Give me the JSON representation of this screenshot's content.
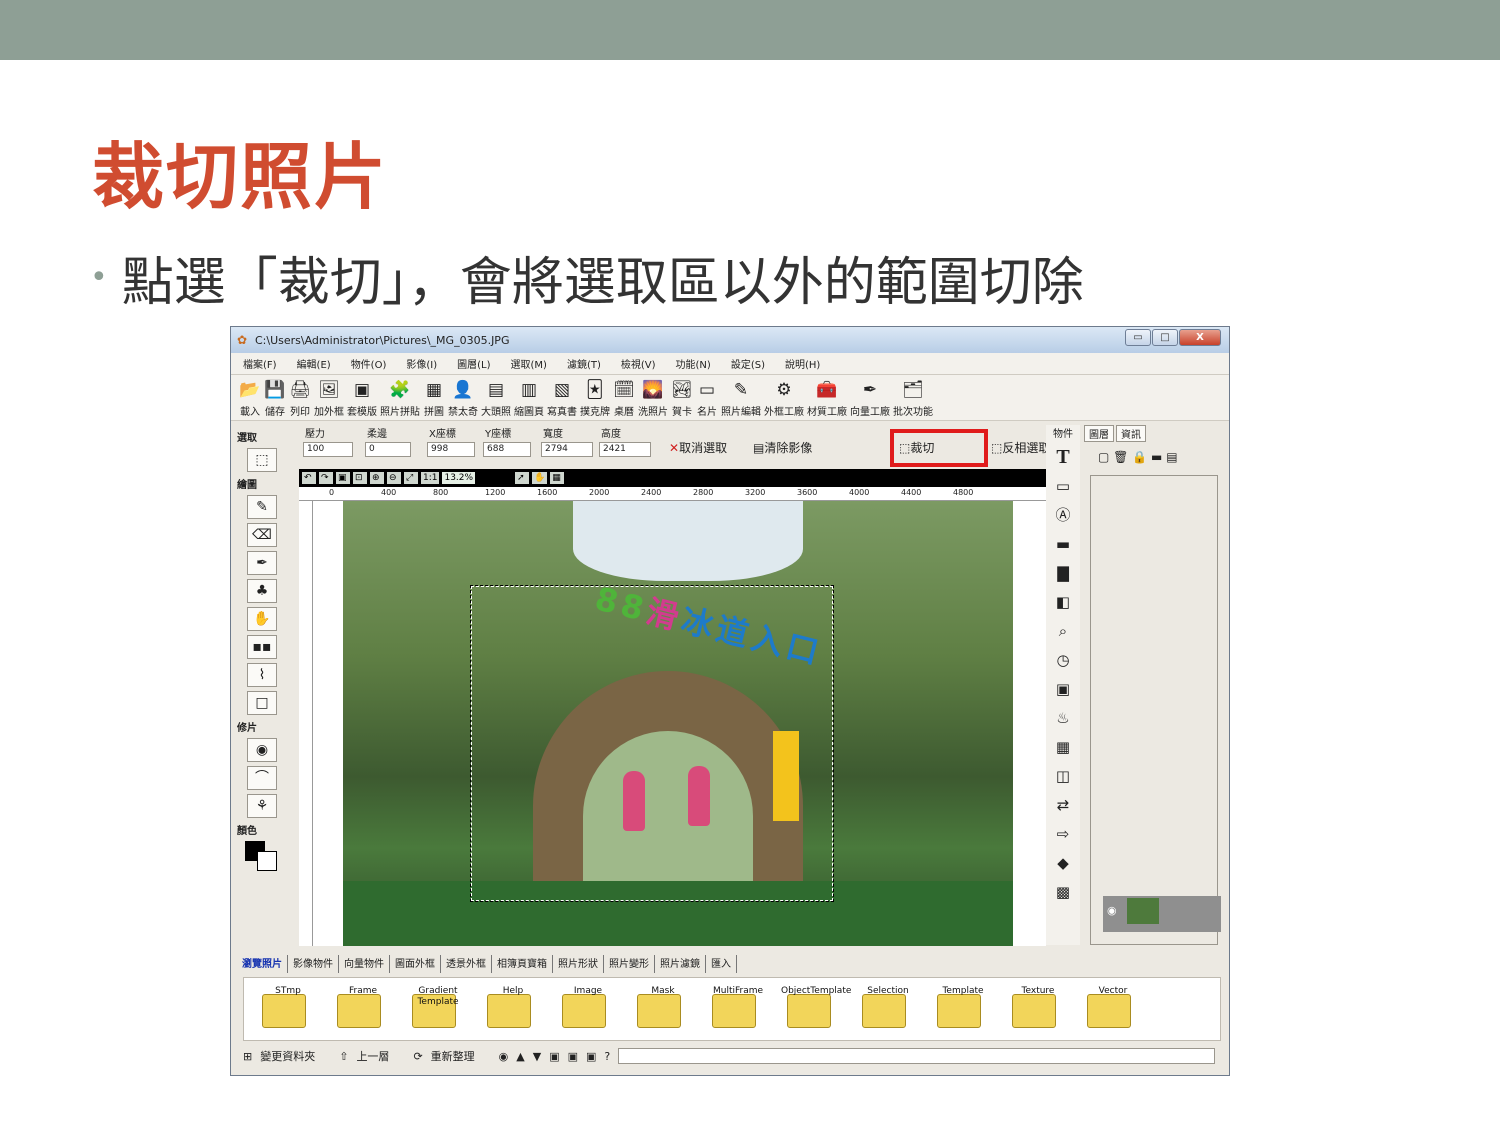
{
  "slide": {
    "title": "裁切照片",
    "bullet": "點選「裁切」，會將選取區以外的範圍切除"
  },
  "window": {
    "title": "C:\\Users\\Administrator\\Pictures\\_MG_0305.JPG",
    "controls": [
      "▭",
      "□",
      "X"
    ]
  },
  "menu": [
    "檔案(F)",
    "編輯(E)",
    "物件(O)",
    "影像(I)",
    "圖層(L)",
    "選取(M)",
    "濾鏡(T)",
    "檢視(V)",
    "功能(N)",
    "設定(S)",
    "說明(H)"
  ],
  "toolbar": [
    {
      "icon": "📂",
      "label": "載入"
    },
    {
      "icon": "💾",
      "label": "儲存"
    },
    {
      "icon": "🖨",
      "label": "列印"
    },
    {
      "icon": "🖼",
      "label": "加外框"
    },
    {
      "icon": "▣",
      "label": "套模版"
    },
    {
      "icon": "🧩",
      "label": "照片拼貼"
    },
    {
      "icon": "▦",
      "label": "拼圖"
    },
    {
      "icon": "👤",
      "label": "禁太奇"
    },
    {
      "icon": "▤",
      "label": "大頭照"
    },
    {
      "icon": "▥",
      "label": "縮圖頁"
    },
    {
      "icon": "▧",
      "label": "寫真書"
    },
    {
      "icon": "🃏",
      "label": "撲克牌"
    },
    {
      "icon": "🗓",
      "label": "桌曆"
    },
    {
      "icon": "🌄",
      "label": "洗照片"
    },
    {
      "icon": "🏞",
      "label": "賀卡"
    },
    {
      "icon": "▭",
      "label": "名片"
    },
    {
      "icon": "✎",
      "label": "照片編輯"
    },
    {
      "icon": "⚙",
      "label": "外框工廠"
    },
    {
      "icon": "🧰",
      "label": "材質工廠"
    },
    {
      "icon": "✒",
      "label": "向量工廠"
    },
    {
      "icon": "🗂",
      "label": "批次功能"
    }
  ],
  "left_panel": {
    "select_label": "選取",
    "draw_label": "繪圖",
    "retouch_label": "修片",
    "color_label": "顏色"
  },
  "options": {
    "pressure_label": "壓力",
    "pressure_value": "100",
    "feather_label": "柔邊",
    "feather_value": "0",
    "x_label": "X座標",
    "x_value": "998",
    "y_label": "Y座標",
    "y_value": "688",
    "width_label": "寬度",
    "width_value": "2794",
    "height_label": "高度",
    "height_value": "2421",
    "cancel_selection": "取消選取",
    "clear_image": "清除影像",
    "crop": "裁切",
    "invert_selection": "反相選取"
  },
  "view": {
    "zoom": "13.2%"
  },
  "ruler_ticks": [
    "0",
    "400",
    "800",
    "1200",
    "1600",
    "2000",
    "2400",
    "2800",
    "3200",
    "3600",
    "4000",
    "4400",
    "4800"
  ],
  "object_panel": {
    "label": "物件"
  },
  "layers": {
    "tabs": [
      "圖層",
      "資訊"
    ]
  },
  "bottom_tabs": [
    "瀏覽照片",
    "影像物件",
    "向量物件",
    "圖面外框",
    "透景外框",
    "相簿頁寶箱",
    "照片形狀",
    "照片變形",
    "照片濾鏡",
    "匯入"
  ],
  "folders": [
    "STmp",
    "Frame",
    "Gradient Template",
    "Help",
    "Image",
    "Mask",
    "MultiFrame",
    "ObjectTemplate",
    "Selection",
    "Template",
    "Texture",
    "Vector"
  ],
  "status": {
    "change_folder": "變更資料夾",
    "up_level": "上一層",
    "refresh": "重新整理",
    "help": "?"
  },
  "colors": {
    "top_band": "#8e9f95",
    "title_red": "#d04c30",
    "highlight_red": "#e01b1b"
  }
}
